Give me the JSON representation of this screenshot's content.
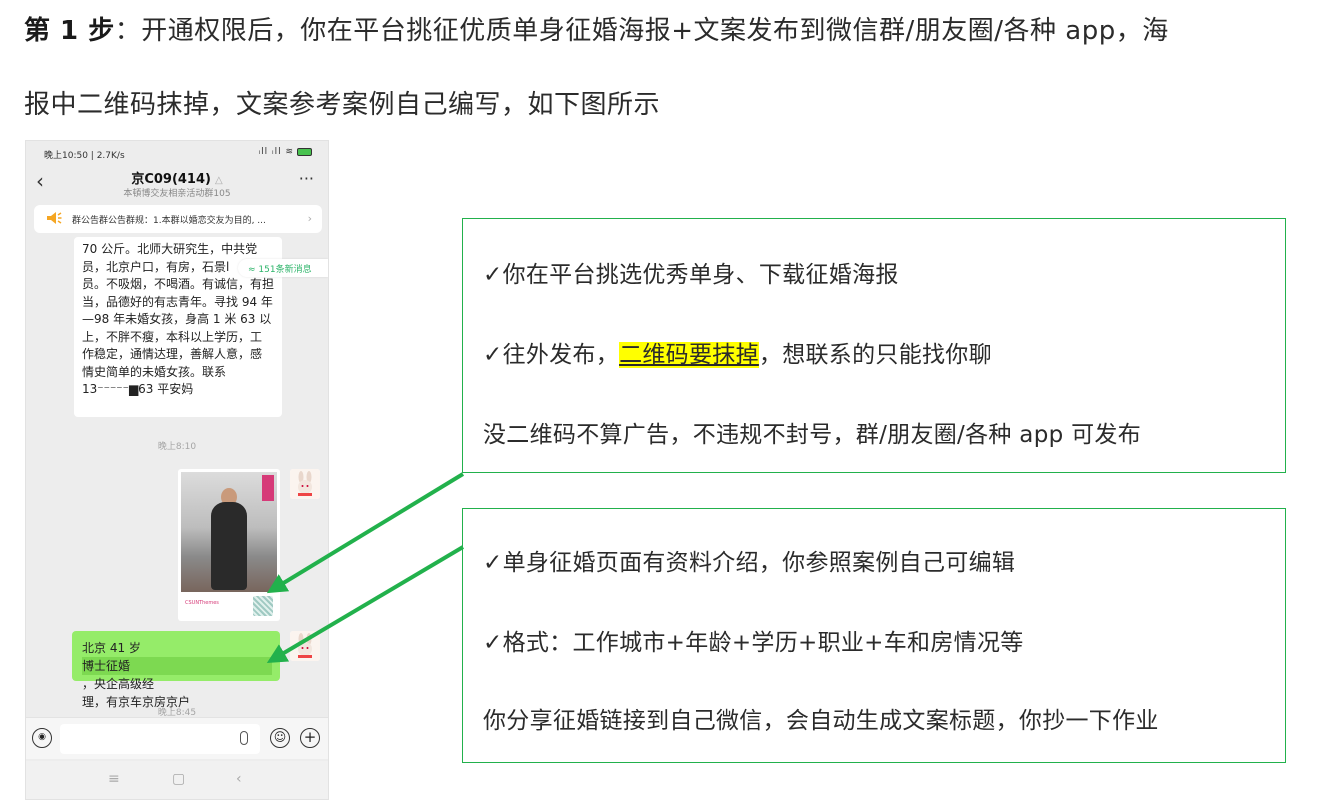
{
  "heading": {
    "step_label": "第 1 步",
    "line1_rest": "：开通权限后，你在平台挑征优质单身征婚海报+文案发布到微信群/朋友圈/各种 app，海",
    "line2": "报中二维码抹掉，文案参考案例自己编写，如下图所示"
  },
  "phone": {
    "status_time": "晚上10:50 | 2.7K/s",
    "status_icons": "ᵢll ᵢll ≋",
    "chat_title": "京C09(414)",
    "chat_subtitle": "本頓博交友相亲活动群105",
    "more_label": "···",
    "notice_text": "群公告群公告群规：1.本群以婚恋交友为目的, ...",
    "unread_badge": "≈ 151条新消息",
    "text_message_lines": [
      "70 公斤。北师大研究生，中共党",
      "员，北京户口，有房，石景l",
      "员。不吸烟，不喝酒。有诚信，有担",
      "当，品德好的有志青年。寻找 94 年",
      "—98 年未婚女孩，身高 1 米 63 以",
      "上，不胖不瘦，本科以上学历，工",
      "作稳定，通情达理，善解人意，感",
      "情史简单的未婚女孩。联系",
      "13⁻⁻⁻⁻⁻▆63 平安妈"
    ],
    "time_1": "晚上8:10",
    "poster_brand": "CSUNThemes",
    "green_line1_pre": "北京 41 岁",
    "green_line1_hl": "博士征婚",
    "green_line1_post": "，央企高级经",
    "green_line2": "理，有京车京房京户",
    "time_2": "晚上8:45",
    "nav_menu": "≡",
    "nav_home": "▢",
    "nav_back": "‹"
  },
  "callout1": {
    "line1": "✓你在平台挑选优秀单身、下载征婚海报",
    "line2_pre": "✓往外发布，",
    "line2_hl": "二维码要抹掉",
    "line2_post": "，想联系的只能找你聊",
    "line3": "没二维码不算广告，不违规不封号，群/朋友圈/各种 app 可发布"
  },
  "callout2": {
    "line1": "✓单身征婚页面有资料介绍，你参照案例自己可编辑",
    "line2": "✓格式：工作城市+年龄+学历+职业+车和房情况等",
    "line3": "你分享征婚链接到自己微信，会自动生成文案标题，你抄一下作业"
  },
  "colors": {
    "callout_border": "#22b14c",
    "arrow": "#22b14c",
    "highlight": "#ffff00",
    "wechat_green": "#95ec69"
  }
}
